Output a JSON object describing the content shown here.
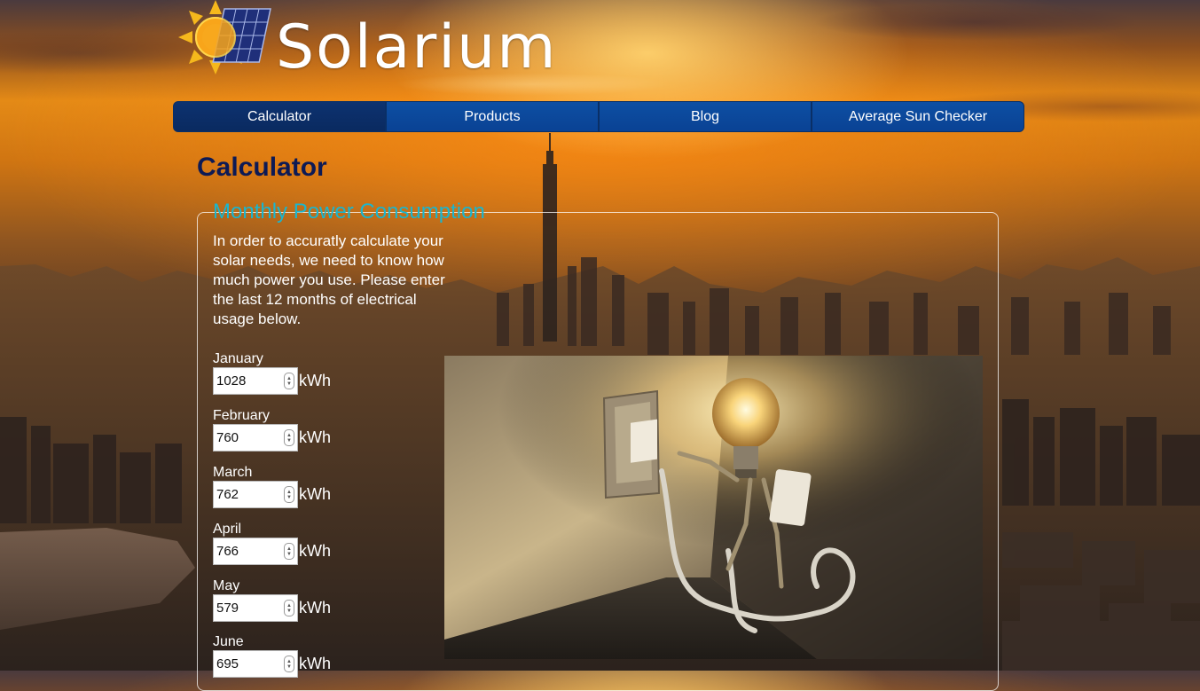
{
  "brand": {
    "name": "Solarium"
  },
  "nav": {
    "items": [
      {
        "label": "Calculator"
      },
      {
        "label": "Products"
      },
      {
        "label": "Blog"
      },
      {
        "label": "Average Sun Checker"
      }
    ],
    "active": "Calculator"
  },
  "page": {
    "title": "Calculator"
  },
  "section": {
    "legend": "Monthly Power Consumption",
    "intro": "In order to accuratly calculate your solar needs, we need to know how much power you use. Please enter the last 12 months of electrical usage below."
  },
  "months": [
    {
      "label": "January",
      "value": "1028",
      "unit": "kWh"
    },
    {
      "label": "February",
      "value": "760",
      "unit": "kWh"
    },
    {
      "label": "March",
      "value": "762",
      "unit": "kWh"
    },
    {
      "label": "April",
      "value": "766",
      "unit": "kWh"
    },
    {
      "label": "May",
      "value": "579",
      "unit": "kWh"
    },
    {
      "label": "June",
      "value": "695",
      "unit": "kWh"
    }
  ],
  "colors": {
    "nav_blue": "#0d4fa3",
    "nav_active": "#0d3270",
    "title": "#0d1a55",
    "legend": "#19b6cf"
  },
  "icons": {
    "logo": "sun-solar-panel-icon",
    "spinner": "spin-arrows-icon"
  }
}
